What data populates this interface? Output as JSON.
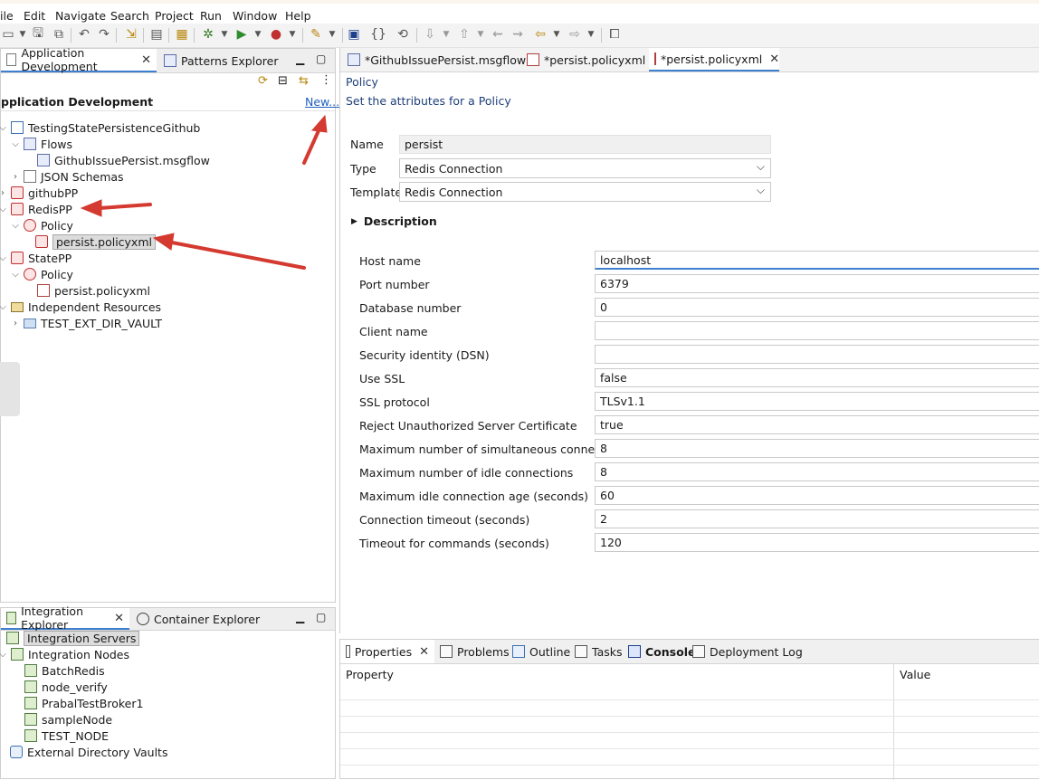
{
  "menu": [
    "ile",
    "Edit",
    "Navigate",
    "Search",
    "Project",
    "Run",
    "Window",
    "Help"
  ],
  "left_panel": {
    "tabs": [
      {
        "label": "Application Development",
        "active": true
      },
      {
        "label": "Patterns Explorer",
        "active": false
      }
    ],
    "header_title": "pplication Development",
    "new_link": "New...",
    "tree": [
      {
        "label": "TestingStatePersistenceGithub",
        "level": 0,
        "icon": "project-icon",
        "chevron": "down"
      },
      {
        "label": "Flows",
        "level": 1,
        "icon": "folder-icon",
        "chevron": "down"
      },
      {
        "label": "GithubIssuePersist.msgflow",
        "level": 2,
        "icon": "msgflow-icon",
        "chevron": ""
      },
      {
        "label": "JSON Schemas",
        "level": 1,
        "icon": "schema-icon",
        "chevron": "right"
      },
      {
        "label": "githubPP",
        "level": 0,
        "icon": "policy-project-icon",
        "chevron": "right"
      },
      {
        "label": "RedisPP",
        "level": 0,
        "icon": "policy-project-icon",
        "chevron": "down"
      },
      {
        "label": "Policy",
        "level": 1,
        "icon": "policy-folder-icon",
        "chevron": "down"
      },
      {
        "label": "persist.policyxml",
        "level": 2,
        "icon": "policy-file-icon",
        "chevron": "",
        "selected": true
      },
      {
        "label": "StatePP",
        "level": 0,
        "icon": "policy-project-icon",
        "chevron": "down"
      },
      {
        "label": "Policy",
        "level": 1,
        "icon": "policy-folder-icon",
        "chevron": "down"
      },
      {
        "label": "persist.policyxml",
        "level": 2,
        "icon": "policy-file-icon",
        "chevron": ""
      },
      {
        "label": "Independent Resources",
        "level": 0,
        "icon": "resources-icon",
        "chevron": "down"
      },
      {
        "label": "TEST_EXT_DIR_VAULT",
        "level": 1,
        "icon": "folder-icon",
        "chevron": "right"
      }
    ]
  },
  "bottom_left_panel": {
    "tabs": [
      {
        "label": "Integration Explorer",
        "active": true
      },
      {
        "label": "Container Explorer",
        "active": false
      }
    ],
    "tree": [
      {
        "label": "Integration Servers",
        "level": 0,
        "icon": "servers-icon",
        "selected": true
      },
      {
        "label": "Integration Nodes",
        "level": 0,
        "icon": "nodes-icon"
      },
      {
        "label": "BatchRedis",
        "level": 1,
        "icon": "node-icon"
      },
      {
        "label": "node_verify",
        "level": 1,
        "icon": "node-icon"
      },
      {
        "label": "PrabalTestBroker1",
        "level": 1,
        "icon": "node-icon"
      },
      {
        "label": "sampleNode",
        "level": 1,
        "icon": "node-icon"
      },
      {
        "label": "TEST_NODE",
        "level": 1,
        "icon": "node-icon"
      },
      {
        "label": "External Directory Vaults",
        "level": 0,
        "icon": "lock-icon"
      }
    ]
  },
  "editor": {
    "tabs": [
      {
        "label": "*GithubIssuePersist.msgflow",
        "active": false
      },
      {
        "label": "*persist.policyxml",
        "active": false
      },
      {
        "label": "*persist.policyxml",
        "active": true
      }
    ],
    "heading": "Policy",
    "subheading": "Set the attributes for a Policy",
    "name_label": "Name",
    "name_value": "persist",
    "type_label": "Type",
    "type_value": "Redis Connection",
    "template_label": "Template",
    "template_value": "Redis Connection",
    "description_label": "Description",
    "properties": [
      {
        "label": "Host name",
        "value": "localhost"
      },
      {
        "label": "Port number",
        "value": "6379"
      },
      {
        "label": "Database number",
        "value": "0"
      },
      {
        "label": "Client name",
        "value": ""
      },
      {
        "label": "Security identity (DSN)",
        "value": ""
      },
      {
        "label": "Use SSL",
        "value": "false"
      },
      {
        "label": "SSL protocol",
        "value": "TLSv1.1"
      },
      {
        "label": "Reject Unauthorized Server Certificate",
        "value": "true"
      },
      {
        "label": "Maximum number of simultaneous connections",
        "value": "8"
      },
      {
        "label": "Maximum number of idle connections",
        "value": "8"
      },
      {
        "label": "Maximum idle connection age (seconds)",
        "value": "60"
      },
      {
        "label": "Connection timeout (seconds)",
        "value": "2"
      },
      {
        "label": "Timeout for commands (seconds)",
        "value": "120"
      }
    ]
  },
  "bottom_panel": {
    "tabs": [
      {
        "label": "Properties",
        "active": true,
        "closable": true
      },
      {
        "label": "Problems",
        "active": false
      },
      {
        "label": "Outline",
        "active": false
      },
      {
        "label": "Tasks",
        "active": false
      },
      {
        "label": "Console",
        "active": false,
        "bold": true
      },
      {
        "label": "Deployment Log",
        "active": false
      }
    ],
    "col_property": "Property",
    "col_value": "Value"
  },
  "colors": {
    "accent": "#3f7fcf",
    "arrow": "#d43a2f",
    "link": "#1f5fbf"
  }
}
